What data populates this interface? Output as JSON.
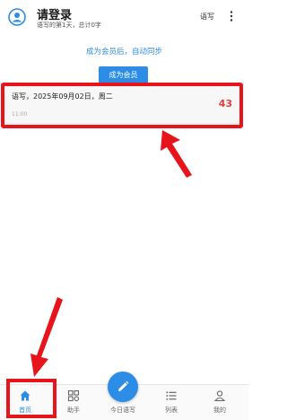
{
  "header": {
    "title": "请登录",
    "subtitle": "语写的第1天，总计0字",
    "action_label": "语写"
  },
  "promo": {
    "sync_text": "成为会员后，自动同步",
    "member_button_label": "成为会员"
  },
  "entries": [
    {
      "title": "语写，2025年09月02日，周二",
      "time": "11:00",
      "count": "43"
    }
  ],
  "bottom_nav": {
    "items": [
      {
        "label": "首页",
        "icon": "home-icon",
        "active": true
      },
      {
        "label": "助手",
        "icon": "grid-icon",
        "active": false
      },
      {
        "label": "今日语写",
        "icon": "pencil-icon",
        "active": false
      },
      {
        "label": "列表",
        "icon": "list-icon",
        "active": false
      },
      {
        "label": "我的",
        "icon": "user-icon",
        "active": false
      }
    ]
  },
  "colors": {
    "accent": "#2d8ce6",
    "count": "#e0413a",
    "annotation": "#e8141c"
  }
}
